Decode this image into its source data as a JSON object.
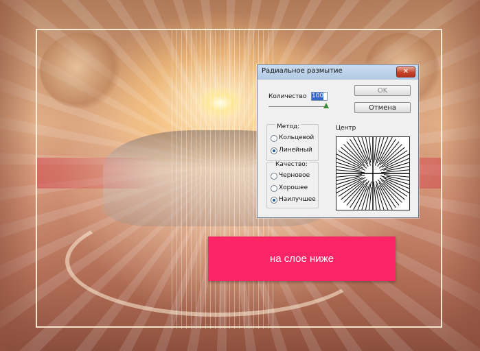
{
  "dialog": {
    "title": "Радиальное размытие",
    "close_label": "✕",
    "amount_label": "Количество",
    "amount_value": "100",
    "ok_label": "OK",
    "cancel_label": "Отмена",
    "method": {
      "title": "Метод:",
      "options": [
        {
          "label": "Кольцевой",
          "selected": false
        },
        {
          "label": "Линейный",
          "selected": true
        }
      ]
    },
    "quality": {
      "title": "Качество:",
      "options": [
        {
          "label": "Черновое",
          "selected": false
        },
        {
          "label": "Хорошее",
          "selected": false
        },
        {
          "label": "Наилучшее",
          "selected": true
        }
      ]
    },
    "center_label": "Центр"
  },
  "banner": {
    "text": "на слое ниже",
    "color": "#fd2565"
  }
}
